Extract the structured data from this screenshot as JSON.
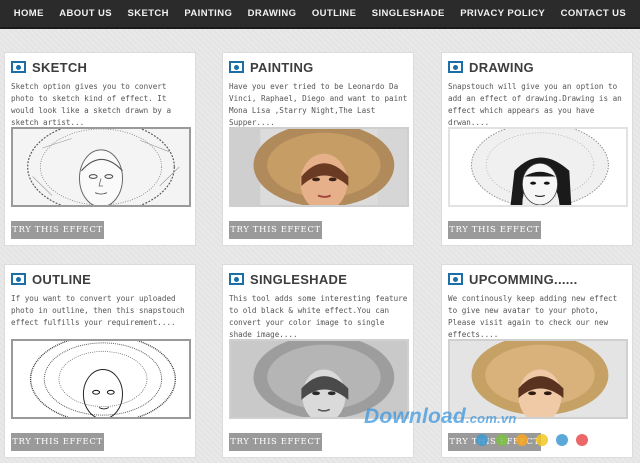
{
  "nav": {
    "items": [
      "HOME",
      "ABOUT US",
      "SKETCH",
      "PAINTING",
      "DRAWING",
      "OUTLINE",
      "SINGLESHADE",
      "PRIVACY POLICY",
      "CONTACT US"
    ]
  },
  "cards": [
    {
      "title": "SKETCH",
      "description": "Sketch option gives you to convert photo to sketch kind of effect. It would look like a sketch drawn by a sketch artist...",
      "button": "TRY THIS EFFECT"
    },
    {
      "title": "PAINTING",
      "description": "Have you ever tried to be Leonardo Da Vinci, Raphael, Diego and want to paint Mona Lisa ,Starry Night,The Last Supper....",
      "button": "TRY THIS EFFECT"
    },
    {
      "title": "DRAWING",
      "description": "Snapstouch will give you an option to add an effect of drawing.Drawing is an effect which appears as you have drwan....",
      "button": "TRY THIS EFFECT"
    },
    {
      "title": "OUTLINE",
      "description": "If you want to convert your uploaded photo in outline, then this snapstouch effect fulfills your requirement....",
      "button": "TRY THIS EFFECT"
    },
    {
      "title": "SINGLESHADE",
      "description": "This tool adds some interesting feature to old black & white effect.You can convert your color image to single shade image....",
      "button": "TRY THIS EFFECT"
    },
    {
      "title": "UPCOMMING......",
      "description": "We continously keep adding new effect to give new avatar to your photo, Please visit again to check our new effects....",
      "button": "TRY THIS EFFECT"
    }
  ],
  "watermark": {
    "main": "Download",
    "suffix": ".com.vn"
  },
  "colors": {
    "nav_bg": "#2b2b2b",
    "accent_icon": "#1b6fa6",
    "button_bg": "#9a9a9a",
    "watermark_dots": [
      "#3d9ad1",
      "#7bc043",
      "#f5a623",
      "#e94e4e",
      "#3d9ad1",
      "#e94e4e"
    ]
  }
}
